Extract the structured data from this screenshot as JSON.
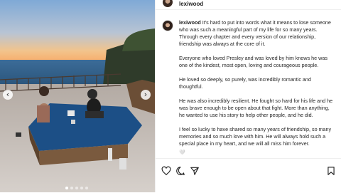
{
  "post": {
    "username": "lexiwood",
    "caption_paragraphs": [
      "It's hard to put into words what it means to lose someone who was such a meaningful part of my life for so many years. Through every chapter and every version of our relationship, friendship was always at the core of it.",
      "Everyone who loved Presley and was loved by him knows he was one of the kindest, most open, loving and courageous people.",
      "He loved so deeply, so purely, was incredibly romantic and thoughtful.",
      "He was also incredibly resilient. He fought so hard for his life and he was brave enough to be open about that fight. More than anything, he wanted to use his story to help other people, and he did.",
      "I feel so lucky to have shared so many years of friendship, so many memories and so much love with him. He will always hold such a special place in my heart, and we will all miss him forever."
    ],
    "trailing_glyph": "🤍"
  },
  "media": {
    "prev_icon": "‹",
    "next_icon": "›",
    "dots": 5,
    "active_dot": 0
  },
  "icons": [
    "heart-icon",
    "comment-icon",
    "share-icon",
    "bookmark-icon"
  ]
}
